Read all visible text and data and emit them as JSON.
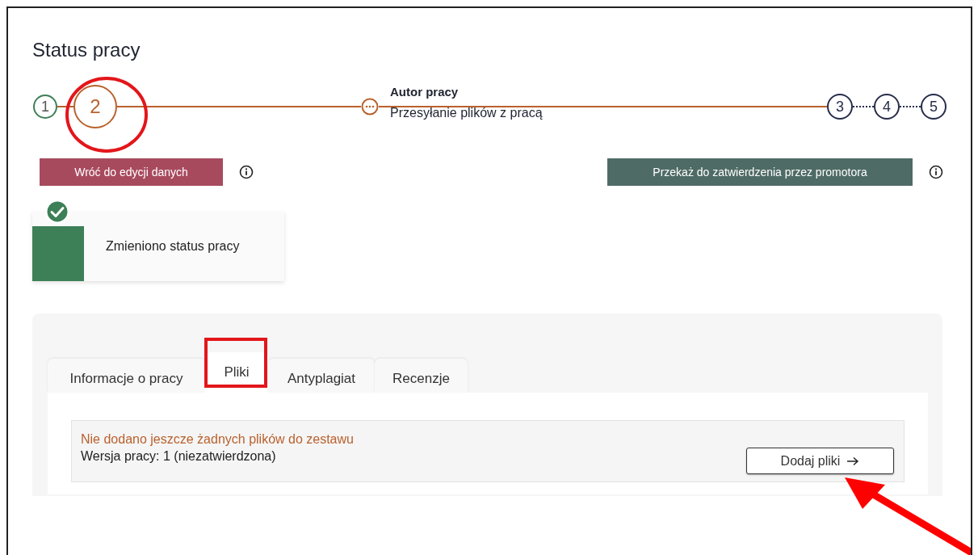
{
  "title": "Status pracy",
  "steps": [
    {
      "label": "1",
      "kind": "done"
    },
    {
      "label": "2",
      "kind": "current"
    },
    {
      "label": "3",
      "kind": "todo"
    },
    {
      "label": "4",
      "kind": "todo"
    },
    {
      "label": "5",
      "kind": "todo"
    }
  ],
  "current_task": {
    "role": "Autor pracy",
    "task": "Przesyłanie plików z pracą"
  },
  "actions": [
    {
      "label": "Wróć do edycji danych",
      "kind": "back"
    },
    {
      "label": "Przekaż do zatwierdzenia przez promotora",
      "kind": "forward"
    }
  ],
  "toast": {
    "message": "Zmieniono status pracy"
  },
  "tabs": [
    {
      "label": "Informacje o pracy",
      "selected": false
    },
    {
      "label": "Pliki",
      "selected": true
    },
    {
      "label": "Antyplagiat",
      "selected": false
    },
    {
      "label": "Recenzje",
      "selected": false
    }
  ],
  "notice": {
    "warning": "Nie dodano jeszcze żadnych plików do zestawu",
    "version": "Wersja pracy: 1 (niezatwierdzona)",
    "button": "Dodaj pliki"
  }
}
